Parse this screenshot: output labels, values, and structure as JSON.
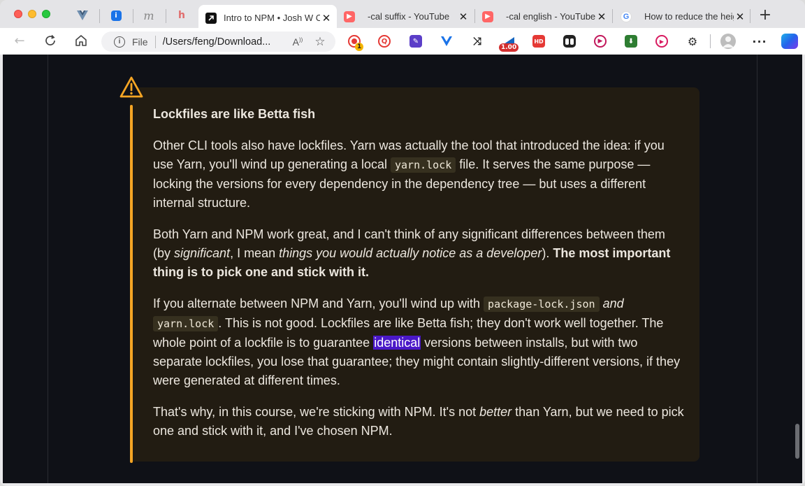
{
  "browser": {
    "tabs": [
      {
        "title": "Intro to NPM • Josh W Comeau",
        "active": true,
        "favicon": "arrow-icon"
      },
      {
        "title": "-cal suffix - YouTube",
        "active": false,
        "favicon": "youtube-icon"
      },
      {
        "title": "-cal english - YouTube",
        "active": false,
        "favicon": "youtube-icon"
      },
      {
        "title": "How to reduce the height",
        "active": false,
        "favicon": "google-icon"
      }
    ],
    "omnibox": {
      "scheme": "File",
      "url": "/Users/feng/Download..."
    },
    "extension_badges": {
      "badge1": "1",
      "badge2": "1.00"
    },
    "colors": {
      "callout_accent": "#f5a524",
      "callout_bg": "#221c12",
      "page_bg": "#0f1117",
      "selection": "#4a18c8"
    }
  },
  "article": {
    "callout_title": "Lockfiles are like Betta fish",
    "p1": {
      "a": "Other CLI tools also have lockfiles. Yarn was actually the tool that introduced the idea: if you use Yarn, you'll wind up generating a local ",
      "code": "yarn.lock",
      "b": " file. It serves the same purpose — locking the versions for every dependency in the dependency tree — but uses a different internal structure."
    },
    "p2": {
      "a": "Both Yarn and NPM work great, and I can't think of any significant differences between them (by ",
      "em1": "significant",
      "b": ", I mean ",
      "em2": "things you would actually notice as a developer",
      "c": "). ",
      "strong": "The most important thing is to pick one and stick with it."
    },
    "p3": {
      "a": "If you alternate between NPM and Yarn, you'll wind up with ",
      "code1": "package-lock.json",
      "em": "and",
      "code2": "yarn.lock",
      "b": ". This is not good. Lockfiles are like Betta fish; they don't work well together. The whole point of a lockfile is to guarantee ",
      "highlight": "identical",
      "c": " versions between installs, but with two separate lockfiles, you lose that guarantee; they might contain slightly-different versions, if they were generated at different times."
    },
    "p4": {
      "a": "That's why, in this course, we're sticking with NPM. It's not ",
      "em": "better",
      "b": " than Yarn, but we need to pick one and stick with it, and I've chosen NPM."
    }
  }
}
